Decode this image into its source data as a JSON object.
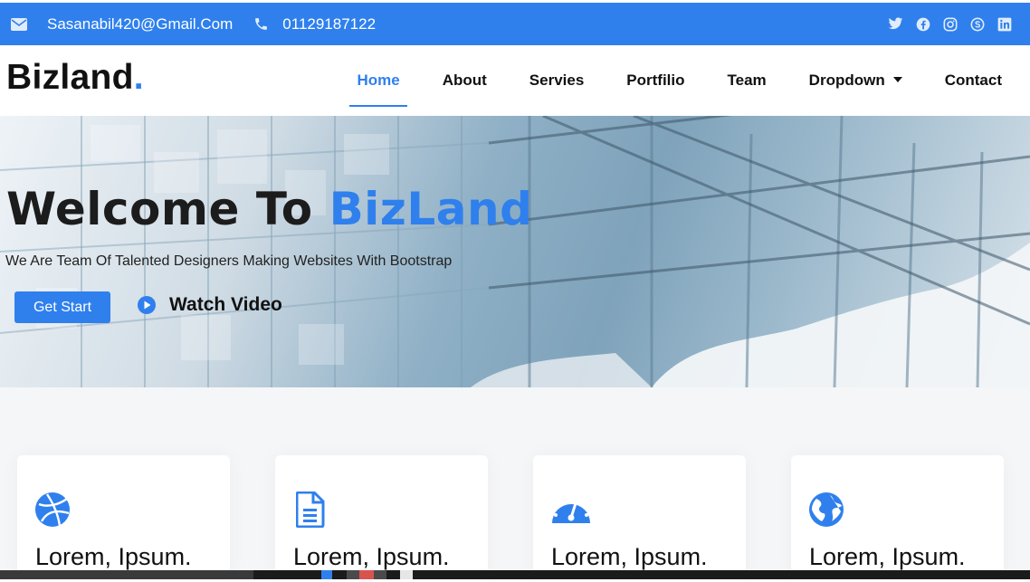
{
  "topbar": {
    "email": "Sasanabil420@Gmail.Com",
    "phone": "01129187122",
    "icons": {
      "email": "envelope-icon",
      "phone": "phone-icon",
      "social": [
        "twitter-icon",
        "facebook-icon",
        "instagram-icon",
        "skype-icon",
        "linkedin-icon"
      ]
    }
  },
  "header": {
    "logo": "Bizland",
    "logo_dot": ".",
    "nav": [
      {
        "label": "Home",
        "active": true
      },
      {
        "label": "About"
      },
      {
        "label": "Servies"
      },
      {
        "label": "Portfilio"
      },
      {
        "label": "Team"
      },
      {
        "label": "Dropdown",
        "has_caret": true
      },
      {
        "label": "Contact"
      }
    ]
  },
  "hero": {
    "title_part1": "Welcome To ",
    "title_brand": "BizLand",
    "subtitle": "We Are Team Of Talented Designers Making Websites With Bootstrap",
    "cta_label": "Get Start",
    "watch_label": "Watch Video",
    "play_icon": "play-circle-icon"
  },
  "services": {
    "cards": [
      {
        "icon": "dribbble-icon",
        "title": "Lorem, Ipsum."
      },
      {
        "icon": "document-icon",
        "title": "Lorem, Ipsum."
      },
      {
        "icon": "speedometer-icon",
        "title": "Lorem, Ipsum."
      },
      {
        "icon": "globe-icon",
        "title": "Lorem, Ipsum."
      }
    ]
  },
  "colors": {
    "accent": "#2f80ed",
    "text": "#111111",
    "section_bg": "#f5f6f8"
  }
}
